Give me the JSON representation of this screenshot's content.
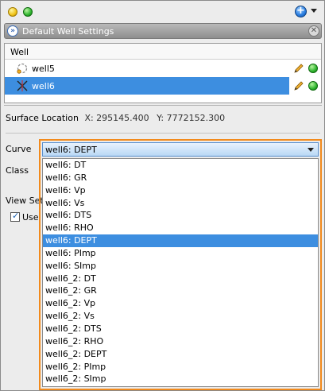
{
  "title": "Default Well Settings",
  "well_table": {
    "header": "Well",
    "rows": [
      {
        "label": "well5",
        "selected": false
      },
      {
        "label": "well6",
        "selected": true
      }
    ]
  },
  "surface_location": {
    "label": "Surface Location",
    "x": "X: 295145.400",
    "y": "Y: 7772152.300"
  },
  "labels": {
    "curve": "Curve",
    "class": "Class",
    "view_settings": "View Set",
    "use": "Use"
  },
  "curve_combo": {
    "value": "well6: DEPT",
    "options": [
      "well6: DT",
      "well6: GR",
      "well6: Vp",
      "well6: Vs",
      "well6: DTS",
      "well6: RHO",
      "well6: DEPT",
      "well6: PImp",
      "well6: SImp",
      "well6_2: DT",
      "well6_2: GR",
      "well6_2: Vp",
      "well6_2: Vs",
      "well6_2: DTS",
      "well6_2: RHO",
      "well6_2: DEPT",
      "well6_2: PImp",
      "well6_2: SImp"
    ],
    "selected_index": 6
  },
  "colors": {
    "selection": "#3d8ee0",
    "highlight_border": "#f28a1c"
  }
}
